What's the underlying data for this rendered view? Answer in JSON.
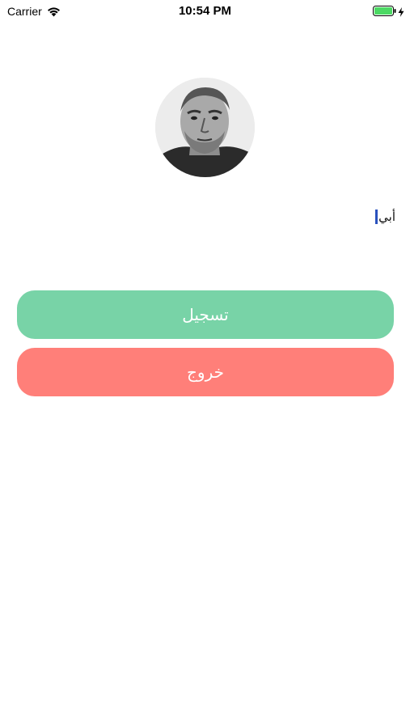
{
  "status_bar": {
    "carrier": "Carrier",
    "time": "10:54 PM",
    "wifi_icon": "wifi-icon",
    "battery_icon": "battery-icon",
    "charging_icon": "bolt-icon",
    "battery_color": "#4cd964"
  },
  "profile": {
    "avatar_icon": "person-photo",
    "name_value": "أبي"
  },
  "actions": {
    "register_label": "تسجيل",
    "register_color": "#78d3a7",
    "exit_label": "خروج",
    "exit_color": "#ff7f79"
  }
}
